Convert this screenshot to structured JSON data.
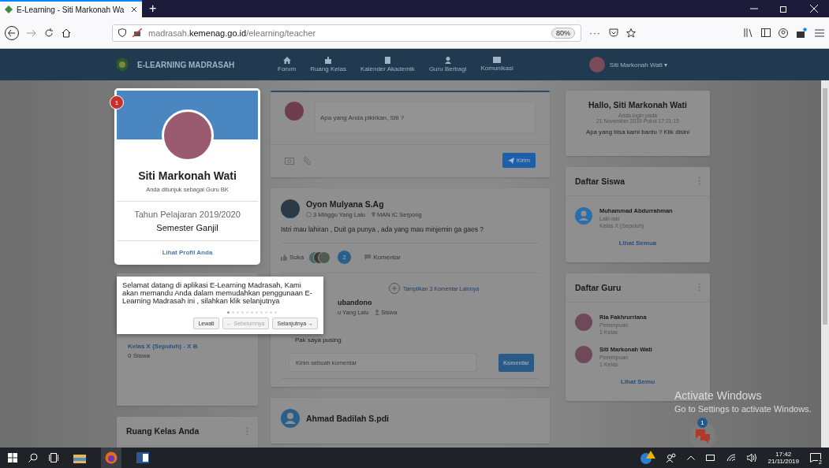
{
  "browser": {
    "tab_title": "E-Learning - Siti Markonah Wa",
    "new_tab": "+",
    "url_host": "madrasah.",
    "url_domain": "kemenag.go.id",
    "url_path": "/elearning/teacher",
    "zoom": "80%",
    "more": "···"
  },
  "navbar": {
    "brand": "E-LEARNING MADRASAH",
    "user": "Siti Markonah Wati",
    "user_caret": "▾",
    "items": [
      {
        "label": "Forum"
      },
      {
        "label": "Ruang Kelas"
      },
      {
        "label": "Kalender Akademik"
      },
      {
        "label": "Guru Berbagi"
      },
      {
        "label": "Komunikasi"
      }
    ]
  },
  "profile": {
    "badge": "1",
    "name": "Siti Markonah Wati",
    "role": "Anda ditunjuk sebagai Guru BK",
    "year": "Tahun Pelajaran 2019/2020",
    "semester": "Semester Ganjil",
    "link": "Lihat Profil Anda"
  },
  "tour": {
    "text": "Selamat datang di aplikasi E-Learning Madrasah, Kami akan memandu Anda dalam memudahkan penggunaan E-Learning Madrasah ini , silahkan klik selanjutnya",
    "steps": [
      {
        "selected": true
      },
      {
        "selected": false
      },
      {
        "selected": false
      },
      {
        "selected": false
      },
      {
        "selected": false
      },
      {
        "selected": false
      },
      {
        "selected": false
      },
      {
        "selected": false
      },
      {
        "selected": false
      },
      {
        "selected": false
      },
      {
        "selected": false
      }
    ],
    "buttons": [
      {
        "label": "Lewati",
        "disabled": false
      },
      {
        "label": "← Sebelumnya",
        "disabled": true
      },
      {
        "label": "Selanjutnya →",
        "disabled": false
      }
    ]
  },
  "classes": {
    "items": [
      {
        "name": "Kelas X (Sepuluh) - X B",
        "count": "0 Siswa"
      }
    ]
  },
  "rooms": {
    "title": "Ruang Kelas Anda"
  },
  "composer": {
    "placeholder": "Apa yang Anda pikirkan, Siti ?",
    "send": "Kirim"
  },
  "post": {
    "author": "Oyon Mulyana S.Ag",
    "time": "3 Minggu Yang Lalu",
    "place": "MAN IC Serpong",
    "text": "Istri mau lahiran , Duit ga punya , ada yang mau minjemin ga gaes ?",
    "like": "Suka",
    "like_count": "2",
    "comment": "Komentar",
    "more_comments": "Tampilkan 3 Komentar Lainnya",
    "reply": {
      "author": "ubandono",
      "time": "u Yang Lalu",
      "role": "Siswa",
      "text": "Pak saya pusing"
    },
    "comment_placeholder": "Kirim sebuah komentar",
    "comment_button": "Komentar"
  },
  "next_post": {
    "author": "Ahmad Badilah S.pdi"
  },
  "hello": {
    "title": "Hallo, Siti Markonah Wati",
    "login_label": "Anda login pada",
    "login_time": "21 November 2019 Pukul 17:21:15",
    "help": "Apa yang bisa kami bantu ? Klik disini"
  },
  "lists": [
    {
      "title": "Daftar Siswa",
      "link": "Lihat Semua",
      "items": [
        {
          "name": "Muhammad Abdurrahman",
          "gender": "Laki-laki",
          "detail": "Kelas X (Sepuluh)"
        }
      ]
    },
    {
      "title": "Daftar Guru",
      "link": "Lihat Semu",
      "items": [
        {
          "name": "Ria Fakhrurriana",
          "gender": "Perempuan",
          "detail": "1 Kelas"
        },
        {
          "name": "Siti Markonah Wati",
          "gender": "Perempuan",
          "detail": "1 Kelas"
        }
      ]
    }
  ],
  "chat": {
    "badge": "1"
  },
  "activation": {
    "title": "Activate Windows",
    "subtitle": "Go to Settings to activate Windows."
  },
  "taskbar": {
    "time": "17:42",
    "date": "21/11/2019",
    "notifications": "2"
  }
}
